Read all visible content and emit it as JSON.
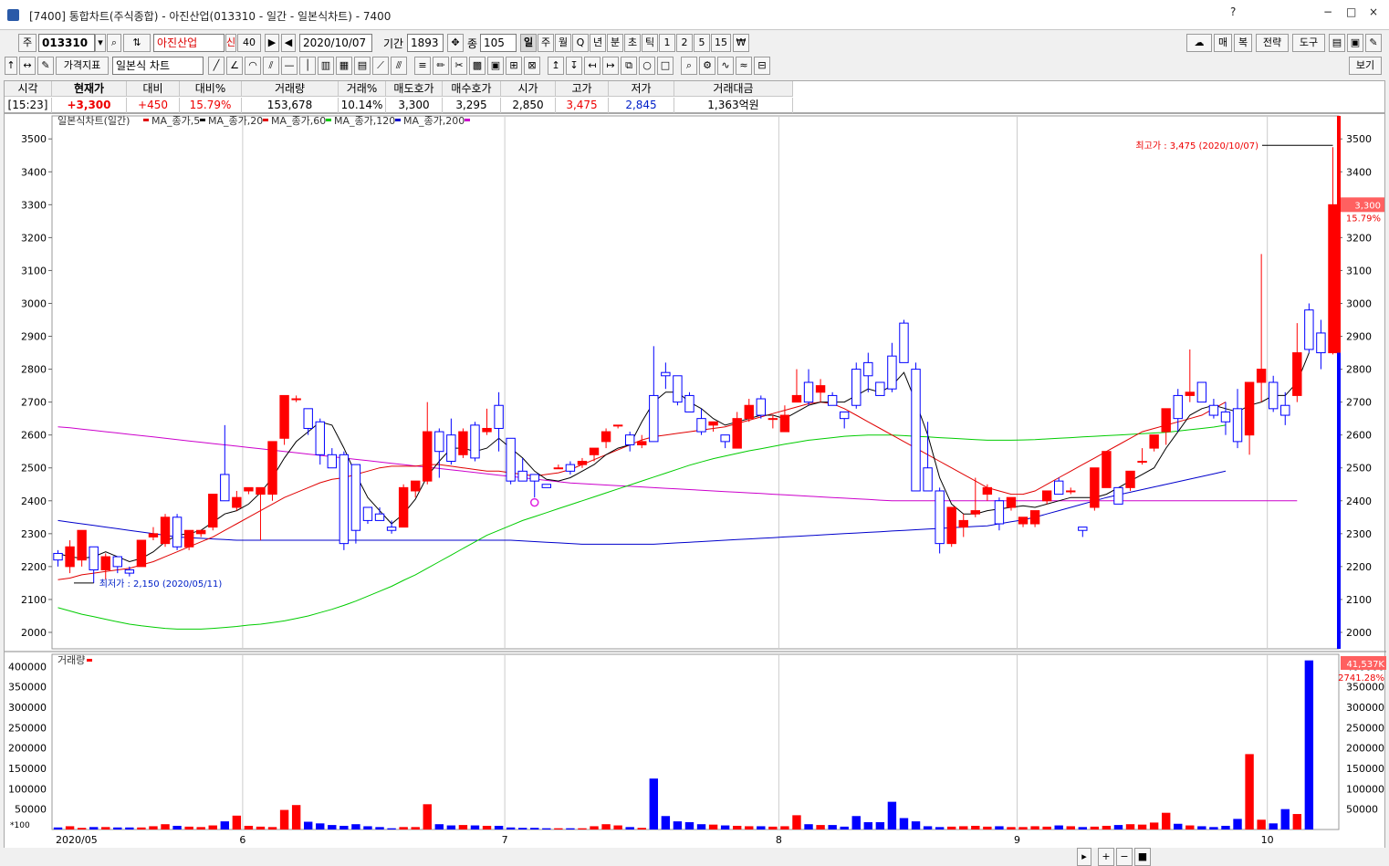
{
  "window": {
    "title": "[7400] 통합차트(주식종합) - 아진산업(013310 - 일간 - 일본식차트) - 7400",
    "controls": [
      "?",
      "−",
      "□",
      "×"
    ]
  },
  "toolbar1": {
    "market": "주",
    "code": "013310",
    "name": "아진산업",
    "credit": "신",
    "margin_rate": "40",
    "date": "2020/10/07",
    "period_label": "기간",
    "period_value": "1893",
    "count_label": "종",
    "count_value": "105",
    "intervals": [
      "일",
      "주",
      "월",
      "Q",
      "년",
      "분",
      "초",
      "틱",
      "1",
      "2",
      "5",
      "15",
      "₩"
    ],
    "right_buttons": [
      "매",
      "복",
      "전략",
      "도구"
    ]
  },
  "toolbar2": {
    "indicator_button": "가격지표",
    "chart_type": "일본식 차트",
    "view_button": "보기"
  },
  "quote": {
    "headers": [
      "시각",
      "현재가",
      "대비",
      "대비%",
      "거래량",
      "거래%",
      "매도호가",
      "매수호가",
      "시가",
      "고가",
      "저가",
      "거래대금"
    ],
    "values": [
      "[15:23]",
      "+3,300",
      "+450",
      "15.79%",
      "153,678",
      "10.14%",
      "3,300",
      "3,295",
      "2,850",
      "3,475",
      "2,845",
      "1,363억원"
    ]
  },
  "legend": {
    "main": "일본식차트(일간)",
    "ma": [
      "MA_종가,5",
      "MA_종가,20",
      "MA_종가,60",
      "MA_종가,120",
      "MA_종가,200"
    ],
    "volume": "거래량"
  },
  "annotations": {
    "high": "최고가 : 3,475 (2020/10/07)",
    "low": "최저가 : 2,150 (2020/05/11)",
    "price_tag": "3,300",
    "price_pct": "15.79%",
    "vol_tag": "41,537K",
    "vol_pct": "2741.28%",
    "vol_unit": "*100"
  },
  "colors": {
    "up": "#ff0000",
    "down": "#0000ff",
    "ma5": "#000000",
    "ma20": "#e00000",
    "ma60": "#00cc00",
    "ma120": "#0000cc",
    "ma200": "#cc00cc"
  },
  "chart_data": {
    "type": "candlestick",
    "y_ticks": [
      2000,
      2100,
      2200,
      2300,
      2400,
      2500,
      2600,
      2700,
      2800,
      2900,
      3000,
      3100,
      3200,
      3300,
      3400,
      3500
    ],
    "ylim": [
      1950,
      3570
    ],
    "vol_ticks": [
      50000,
      100000,
      150000,
      200000,
      250000,
      300000,
      350000,
      400000
    ],
    "vol_ylim": [
      0,
      430000
    ],
    "x_labels": [
      {
        "i": 0,
        "t": "2020/05"
      },
      {
        "i": 16,
        "t": "6"
      },
      {
        "i": 38,
        "t": "7"
      },
      {
        "i": 61,
        "t": "8"
      },
      {
        "i": 81,
        "t": "9"
      },
      {
        "i": 102,
        "t": "10"
      }
    ],
    "ohlc": [
      [
        2240,
        2250,
        2200,
        2220
      ],
      [
        2200,
        2280,
        2180,
        2260
      ],
      [
        2220,
        2310,
        2200,
        2310
      ],
      [
        2260,
        2260,
        2150,
        2190
      ],
      [
        2190,
        2240,
        2160,
        2230
      ],
      [
        2230,
        2230,
        2180,
        2200
      ],
      [
        2190,
        2200,
        2170,
        2180
      ],
      [
        2200,
        2280,
        2200,
        2280
      ],
      [
        2290,
        2320,
        2280,
        2300
      ],
      [
        2270,
        2360,
        2260,
        2350
      ],
      [
        2350,
        2360,
        2250,
        2260
      ],
      [
        2260,
        2310,
        2250,
        2310
      ],
      [
        2300,
        2310,
        2290,
        2310
      ],
      [
        2320,
        2420,
        2310,
        2420
      ],
      [
        2480,
        2630,
        2400,
        2400
      ],
      [
        2380,
        2430,
        2370,
        2410
      ],
      [
        2430,
        2440,
        2420,
        2440
      ],
      [
        2420,
        2440,
        2280,
        2440
      ],
      [
        2420,
        2580,
        2400,
        2580
      ],
      [
        2590,
        2720,
        2570,
        2720
      ],
      [
        2710,
        2720,
        2700,
        2710
      ],
      [
        2680,
        2680,
        2600,
        2620
      ],
      [
        2640,
        2650,
        2510,
        2540
      ],
      [
        2540,
        2560,
        2500,
        2500
      ],
      [
        2540,
        2550,
        2250,
        2270
      ],
      [
        2510,
        2510,
        2270,
        2310
      ],
      [
        2380,
        2380,
        2330,
        2340
      ],
      [
        2360,
        2380,
        2340,
        2340
      ],
      [
        2320,
        2340,
        2300,
        2310
      ],
      [
        2320,
        2450,
        2320,
        2440
      ],
      [
        2430,
        2460,
        2410,
        2460
      ],
      [
        2460,
        2700,
        2450,
        2610
      ],
      [
        2610,
        2620,
        2470,
        2550
      ],
      [
        2600,
        2650,
        2510,
        2520
      ],
      [
        2540,
        2620,
        2530,
        2610
      ],
      [
        2630,
        2640,
        2520,
        2530
      ],
      [
        2610,
        2680,
        2600,
        2620
      ],
      [
        2690,
        2730,
        2550,
        2620
      ],
      [
        2590,
        2590,
        2450,
        2460
      ],
      [
        2490,
        2530,
        2460,
        2460
      ],
      [
        2480,
        2480,
        2410,
        2460
      ],
      [
        2450,
        2450,
        2440,
        2440
      ],
      [
        2500,
        2510,
        2500,
        2500
      ],
      [
        2510,
        2520,
        2480,
        2490
      ],
      [
        2510,
        2530,
        2500,
        2520
      ],
      [
        2540,
        2560,
        2520,
        2560
      ],
      [
        2580,
        2620,
        2560,
        2610
      ],
      [
        2630,
        2630,
        2620,
        2630
      ],
      [
        2600,
        2610,
        2550,
        2570
      ],
      [
        2570,
        2600,
        2560,
        2580
      ],
      [
        2720,
        2870,
        2580,
        2580
      ],
      [
        2790,
        2820,
        2740,
        2780
      ],
      [
        2780,
        2780,
        2690,
        2700
      ],
      [
        2720,
        2730,
        2670,
        2670
      ],
      [
        2650,
        2680,
        2600,
        2610
      ],
      [
        2630,
        2640,
        2610,
        2640
      ],
      [
        2600,
        2600,
        2560,
        2580
      ],
      [
        2560,
        2670,
        2560,
        2650
      ],
      [
        2650,
        2710,
        2640,
        2690
      ],
      [
        2710,
        2720,
        2650,
        2660
      ],
      [
        2650,
        2660,
        2620,
        2650
      ],
      [
        2610,
        2690,
        2610,
        2660
      ],
      [
        2700,
        2800,
        2700,
        2720
      ],
      [
        2760,
        2800,
        2690,
        2700
      ],
      [
        2730,
        2770,
        2700,
        2750
      ],
      [
        2720,
        2730,
        2690,
        2690
      ],
      [
        2670,
        2670,
        2620,
        2650
      ],
      [
        2800,
        2820,
        2680,
        2690
      ],
      [
        2820,
        2850,
        2730,
        2780
      ],
      [
        2760,
        2760,
        2720,
        2720
      ],
      [
        2840,
        2880,
        2730,
        2740
      ],
      [
        2940,
        2950,
        2830,
        2820
      ],
      [
        2800,
        2820,
        2460,
        2430
      ],
      [
        2500,
        2640,
        2440,
        2430
      ],
      [
        2430,
        2440,
        2240,
        2270
      ],
      [
        2270,
        2380,
        2260,
        2380
      ],
      [
        2320,
        2360,
        2290,
        2340
      ],
      [
        2360,
        2470,
        2350,
        2370
      ],
      [
        2420,
        2450,
        2400,
        2440
      ],
      [
        2400,
        2410,
        2310,
        2330
      ],
      [
        2380,
        2410,
        2370,
        2410
      ],
      [
        2330,
        2350,
        2320,
        2350
      ],
      [
        2330,
        2370,
        2320,
        2370
      ],
      [
        2400,
        2420,
        2390,
        2430
      ],
      [
        2460,
        2470,
        2420,
        2420
      ],
      [
        2430,
        2440,
        2420,
        2430
      ],
      [
        2320,
        2310,
        2290,
        2310
      ],
      [
        2380,
        2500,
        2370,
        2500
      ],
      [
        2440,
        2550,
        2440,
        2550
      ],
      [
        2440,
        2440,
        2390,
        2390
      ],
      [
        2440,
        2480,
        2430,
        2490
      ],
      [
        2520,
        2560,
        2510,
        2520
      ],
      [
        2560,
        2600,
        2550,
        2600
      ],
      [
        2610,
        2660,
        2570,
        2680
      ],
      [
        2720,
        2740,
        2610,
        2650
      ],
      [
        2720,
        2860,
        2700,
        2730
      ],
      [
        2760,
        2760,
        2700,
        2700
      ],
      [
        2690,
        2710,
        2650,
        2660
      ],
      [
        2670,
        2700,
        2600,
        2640
      ],
      [
        2680,
        2740,
        2560,
        2580
      ],
      [
        2600,
        2760,
        2540,
        2760
      ],
      [
        2760,
        3150,
        2700,
        2800
      ],
      [
        2760,
        2780,
        2670,
        2680
      ],
      [
        2690,
        2730,
        2630,
        2660
      ],
      [
        2720,
        2940,
        2700,
        2850
      ],
      [
        2980,
        3000,
        2850,
        2860
      ],
      [
        2910,
        2950,
        2800,
        2850
      ],
      [
        2850,
        3475,
        2845,
        3300
      ]
    ],
    "volume": [
      50,
      80,
      40,
      60,
      60,
      50,
      50,
      50,
      80,
      130,
      90,
      70,
      60,
      100,
      200,
      340,
      90,
      70,
      60,
      480,
      600,
      190,
      150,
      110,
      90,
      130,
      80,
      60,
      30,
      60,
      60,
      620,
      130,
      100,
      110,
      100,
      90,
      90,
      50,
      40,
      40,
      30,
      30,
      30,
      30,
      80,
      130,
      100,
      60,
      40,
      1250,
      330,
      200,
      180,
      130,
      120,
      100,
      90,
      80,
      80,
      70,
      80,
      350,
      130,
      110,
      110,
      70,
      330,
      180,
      180,
      680,
      280,
      200,
      80,
      60,
      70,
      80,
      90,
      70,
      80,
      60,
      60,
      80,
      70,
      100,
      80,
      60,
      70,
      90,
      110,
      130,
      120,
      170,
      410,
      140,
      100,
      80,
      60,
      90,
      260,
      1850,
      240,
      150,
      500,
      380,
      4150
    ],
    "ma": {
      "ma5": [
        2240,
        2230,
        2225,
        2230,
        2245,
        2230,
        2215,
        2225,
        2245,
        2275,
        2295,
        2300,
        2310,
        2335,
        2360,
        2370,
        2390,
        2425,
        2470,
        2530,
        2580,
        2610,
        2640,
        2630,
        2560,
        2480,
        2410,
        2370,
        2330,
        2360,
        2405,
        2475,
        2520,
        2560,
        2560,
        2550,
        2560,
        2590,
        2560,
        2530,
        2490,
        2465,
        2460,
        2470,
        2490,
        2510,
        2540,
        2560,
        2570,
        2640,
        2700,
        2730,
        2730,
        2700,
        2680,
        2650,
        2630,
        2640,
        2650,
        2660,
        2660,
        2650,
        2670,
        2690,
        2700,
        2700,
        2700,
        2720,
        2740,
        2730,
        2750,
        2790,
        2700,
        2600,
        2470,
        2390,
        2360,
        2360,
        2370,
        2375,
        2380,
        2385,
        2380,
        2390,
        2400,
        2410,
        2410,
        2410,
        2420,
        2440,
        2460,
        2480,
        2500,
        2560,
        2610,
        2660,
        2680,
        2690,
        2680,
        2670,
        2690,
        2700,
        2720,
        2720,
        2760,
        2850
      ],
      "ma20": [
        2160,
        2165,
        2175,
        2180,
        2185,
        2190,
        2195,
        2205,
        2215,
        2230,
        2245,
        2260,
        2275,
        2290,
        2310,
        2330,
        2350,
        2370,
        2390,
        2410,
        2425,
        2440,
        2455,
        2465,
        2470,
        2480,
        2490,
        2500,
        2505,
        2505,
        2505,
        2510,
        2510,
        2505,
        2500,
        2495,
        2490,
        2490,
        2485,
        2480,
        2475,
        2480,
        2485,
        2495,
        2510,
        2525,
        2540,
        2555,
        2570,
        2585,
        2595,
        2600,
        2605,
        2610,
        2615,
        2620,
        2625,
        2635,
        2645,
        2655,
        2665,
        2675,
        2685,
        2695,
        2700,
        2695,
        2680,
        2660,
        2640,
        2620,
        2600,
        2580,
        2560,
        2540,
        2520,
        2500,
        2480,
        2460,
        2440,
        2430,
        2420,
        2420,
        2430,
        2450,
        2470,
        2490,
        2510,
        2530,
        2550,
        2570,
        2590,
        2610,
        2620,
        2630,
        2640,
        2650,
        2660,
        2680,
        2700
      ],
      "ma60": [
        2075,
        2065,
        2055,
        2048,
        2040,
        2032,
        2025,
        2020,
        2016,
        2012,
        2010,
        2010,
        2010,
        2012,
        2015,
        2018,
        2022,
        2025,
        2030,
        2035,
        2042,
        2050,
        2060,
        2070,
        2082,
        2095,
        2110,
        2125,
        2140,
        2158,
        2175,
        2195,
        2215,
        2235,
        2255,
        2275,
        2295,
        2310,
        2325,
        2340,
        2352,
        2364,
        2376,
        2388,
        2400,
        2412,
        2424,
        2436,
        2448,
        2460,
        2472,
        2484,
        2496,
        2508,
        2518,
        2528,
        2536,
        2544,
        2552,
        2558,
        2565,
        2572,
        2578,
        2584,
        2588,
        2592,
        2596,
        2598,
        2600,
        2600,
        2600,
        2598,
        2596,
        2594,
        2592,
        2590,
        2588,
        2586,
        2584,
        2584,
        2584,
        2585,
        2586,
        2588,
        2590,
        2592,
        2594,
        2596,
        2598,
        2600,
        2602,
        2604,
        2606,
        2608,
        2612,
        2616,
        2620,
        2624,
        2630
      ],
      "ma120": [
        2340,
        2335,
        2330,
        2325,
        2320,
        2315,
        2310,
        2305,
        2300,
        2295,
        2290,
        2288,
        2286,
        2284,
        2282,
        2280,
        2280,
        2280,
        2280,
        2280,
        2280,
        2280,
        2280,
        2280,
        2280,
        2280,
        2280,
        2280,
        2280,
        2280,
        2280,
        2280,
        2280,
        2280,
        2280,
        2280,
        2280,
        2280,
        2280,
        2278,
        2276,
        2274,
        2272,
        2270,
        2268,
        2268,
        2268,
        2268,
        2268,
        2268,
        2268,
        2270,
        2272,
        2274,
        2276,
        2278,
        2280,
        2282,
        2284,
        2286,
        2288,
        2290,
        2292,
        2294,
        2296,
        2298,
        2300,
        2302,
        2304,
        2306,
        2308,
        2310,
        2312,
        2314,
        2316,
        2318,
        2320,
        2322,
        2324,
        2330,
        2336,
        2342,
        2350,
        2360,
        2370,
        2380,
        2390,
        2400,
        2410,
        2418,
        2426,
        2434,
        2442,
        2450,
        2458,
        2466,
        2474,
        2482,
        2490
      ],
      "ma200": [
        2625,
        2622,
        2618,
        2614,
        2610,
        2606,
        2602,
        2598,
        2594,
        2590,
        2586,
        2582,
        2578,
        2574,
        2570,
        2566,
        2562,
        2558,
        2554,
        2550,
        2546,
        2542,
        2538,
        2534,
        2530,
        2526,
        2522,
        2518,
        2514,
        2510,
        2506,
        2502,
        2498,
        2494,
        2490,
        2486,
        2482,
        2478,
        2474,
        2470,
        2466,
        2462,
        2458,
        2454,
        2452,
        2450,
        2448,
        2446,
        2444,
        2442,
        2440,
        2438,
        2436,
        2434,
        2432,
        2430,
        2428,
        2426,
        2424,
        2422,
        2420,
        2418,
        2416,
        2414,
        2412,
        2410,
        2408,
        2406,
        2404,
        2402,
        2400,
        2400,
        2400,
        2400,
        2400,
        2400,
        2400,
        2400,
        2400,
        2400,
        2400,
        2400,
        2400,
        2400,
        2400,
        2400,
        2400,
        2400,
        2400,
        2400,
        2400,
        2400,
        2400,
        2400,
        2400,
        2400,
        2400,
        2400,
        2400,
        2400,
        2400,
        2400,
        2400,
        2400,
        2400
      ]
    }
  }
}
